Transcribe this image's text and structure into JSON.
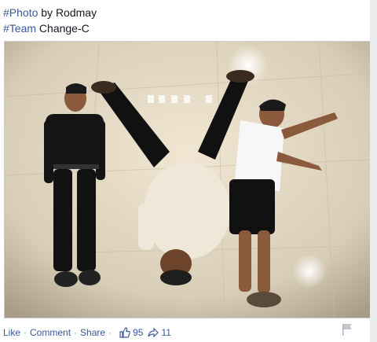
{
  "caption": {
    "line0": "                              ",
    "line1": {
      "hashtag": "#Photo",
      "text": " by Rodmay"
    },
    "line2": {
      "hashtag": "#Team",
      "text": " Change-C"
    }
  },
  "photo": {
    "alt": "Three people lying on the floor forming letters"
  },
  "actions": {
    "like": "Like",
    "comment": "Comment",
    "share": "Share",
    "separator": "·",
    "like_count": "95",
    "share_count": "11"
  },
  "colors": {
    "link": "#3b5998",
    "text": "#141823",
    "muted": "#9197a3"
  },
  "icons": [
    "thumbs-up-icon",
    "share-arrow-icon",
    "flag-icon"
  ]
}
